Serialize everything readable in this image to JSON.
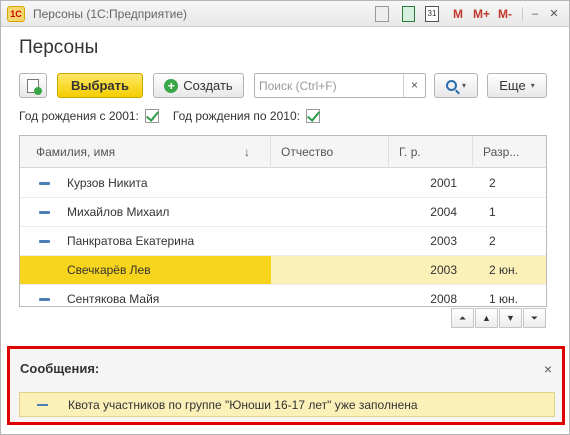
{
  "titlebar": {
    "logo": "1С",
    "title": "Персоны  (1С:Предприятие)",
    "icons": [
      "document-icon",
      "calculator-icon",
      "calendar-icon"
    ],
    "calendar_day": "31",
    "m_labels": [
      "M",
      "M+",
      "M-"
    ],
    "min_label": "–",
    "max_label": "□",
    "close_label": "✕"
  },
  "page": {
    "title": "Персоны"
  },
  "toolbar": {
    "select_label": "Выбрать",
    "create_label": "Создать",
    "search_placeholder": "Поиск (Ctrl+F)",
    "search_value": "",
    "clear_label": "×",
    "more_label": "Еще",
    "caret": "▾"
  },
  "filters": {
    "from_label": "Год рождения с 2001:",
    "from_checked": true,
    "to_label": "Год рождения по 2010:",
    "to_checked": true
  },
  "table": {
    "columns": [
      "Фамилия, имя",
      "Отчество",
      "Г. р.",
      "Разр..."
    ],
    "sort_arrow": "↓",
    "rows": [
      {
        "name": "Курзов Никита",
        "patronymic": "",
        "year": "2001",
        "rank": "2"
      },
      {
        "name": "Михайлов Михаил",
        "patronymic": "",
        "year": "2004",
        "rank": "1"
      },
      {
        "name": "Панкратова Екатерина",
        "patronymic": "",
        "year": "2003",
        "rank": "2"
      },
      {
        "name": "Свечкарёв Лев",
        "patronymic": "",
        "year": "2003",
        "rank": "2 юн.",
        "selected": true
      },
      {
        "name": "Сентякова Майя",
        "patronymic": "",
        "year": "2008",
        "rank": "1 юн."
      }
    ],
    "nav": [
      "⏶",
      "▲",
      "▼",
      "⏷"
    ]
  },
  "messages": {
    "title": "Сообщения:",
    "close_label": "×",
    "text": "Квота участников по группе \"Юноши 16-17 лет\" уже заполнена"
  },
  "colors": {
    "accent_yellow": "#f7d51d",
    "selected_row": "#fbf0b8",
    "highlight_border": "#e00000",
    "check_green": "#2e9a47"
  }
}
